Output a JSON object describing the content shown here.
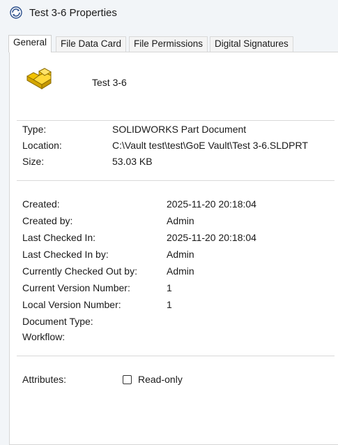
{
  "window": {
    "title": "Test 3-6 Properties"
  },
  "tabs": [
    {
      "label": "General"
    },
    {
      "label": "File Data Card"
    },
    {
      "label": "File Permissions"
    },
    {
      "label": "Digital Signatures"
    }
  ],
  "file": {
    "name": "Test 3-6",
    "icon": "solidworks-part-icon",
    "accent_color": "#f2c200"
  },
  "info": [
    {
      "label": "Type:",
      "value": "SOLIDWORKS Part Document"
    },
    {
      "label": "Location:",
      "value": "C:\\Vault test\\test\\GoE Vault\\Test 3-6.SLDPRT"
    },
    {
      "label": "Size:",
      "value": "53.03 KB"
    }
  ],
  "details": [
    {
      "label": "Created:",
      "value": "2025-11-20 20:18:04"
    },
    {
      "label": "Created by:",
      "value": "Admin"
    },
    {
      "label": "Last Checked In:",
      "value": "2025-11-20 20:18:04"
    },
    {
      "label": "Last Checked In by:",
      "value": "Admin"
    },
    {
      "label": "Currently Checked Out by:",
      "value": "Admin"
    },
    {
      "label": "Current Version Number:",
      "value": "1"
    },
    {
      "label": "Local Version Number:",
      "value": "1"
    },
    {
      "label": "Document Type:",
      "value": ""
    },
    {
      "label": "Workflow:",
      "value": ""
    }
  ],
  "attributes": {
    "label": "Attributes:",
    "readonly_label": "Read-only",
    "readonly_checked": false
  }
}
